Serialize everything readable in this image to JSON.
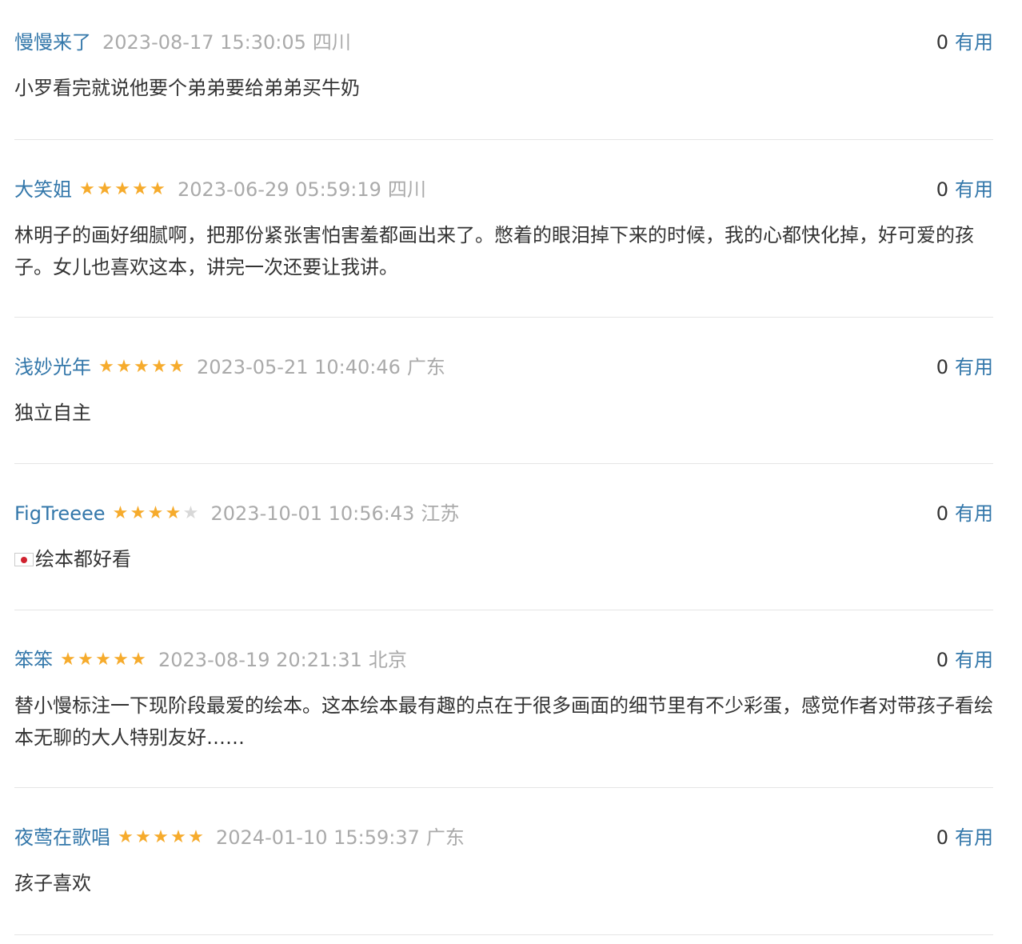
{
  "vote_label": "有用",
  "colors": {
    "username": "#3377aa",
    "meta": "#aaaaaa",
    "text": "#333333",
    "star_on": "#f6ab2c",
    "star_off": "#d8d8d8",
    "divider": "#e5e5e5"
  },
  "comments": [
    {
      "user": "慢慢来了",
      "rating": 0,
      "time": "2023-08-17 15:30:05",
      "location": "四川",
      "votes": "0",
      "content": "小罗看完就说他要个弟弟要给弟弟买牛奶"
    },
    {
      "user": "大笑姐",
      "rating": 5,
      "time": "2023-06-29 05:59:19",
      "location": "四川",
      "votes": "0",
      "content": "林明子的画好细腻啊，把那份紧张害怕害羞都画出来了。憋着的眼泪掉下来的时候，我的心都快化掉，好可爱的孩子。女儿也喜欢这本，讲完一次还要让我讲。"
    },
    {
      "user": "浅妙光年",
      "rating": 5,
      "time": "2023-05-21 10:40:46",
      "location": "广东",
      "votes": "0",
      "content": "独立自主"
    },
    {
      "user": "FigTreeee",
      "rating": 4,
      "time": "2023-10-01 10:56:43",
      "location": "江苏",
      "votes": "0",
      "content": "绘本都好看",
      "leading_icon": "japan-flag-icon"
    },
    {
      "user": "笨笨",
      "rating": 5,
      "time": "2023-08-19 20:21:31",
      "location": "北京",
      "votes": "0",
      "content": "替小慢标注一下现阶段最爱的绘本。这本绘本最有趣的点在于很多画面的细节里有不少彩蛋，感觉作者对带孩子看绘本无聊的大人特别友好……"
    },
    {
      "user": "夜莺在歌唱",
      "rating": 5,
      "time": "2024-01-10 15:59:37",
      "location": "广东",
      "votes": "0",
      "content": "孩子喜欢"
    }
  ]
}
